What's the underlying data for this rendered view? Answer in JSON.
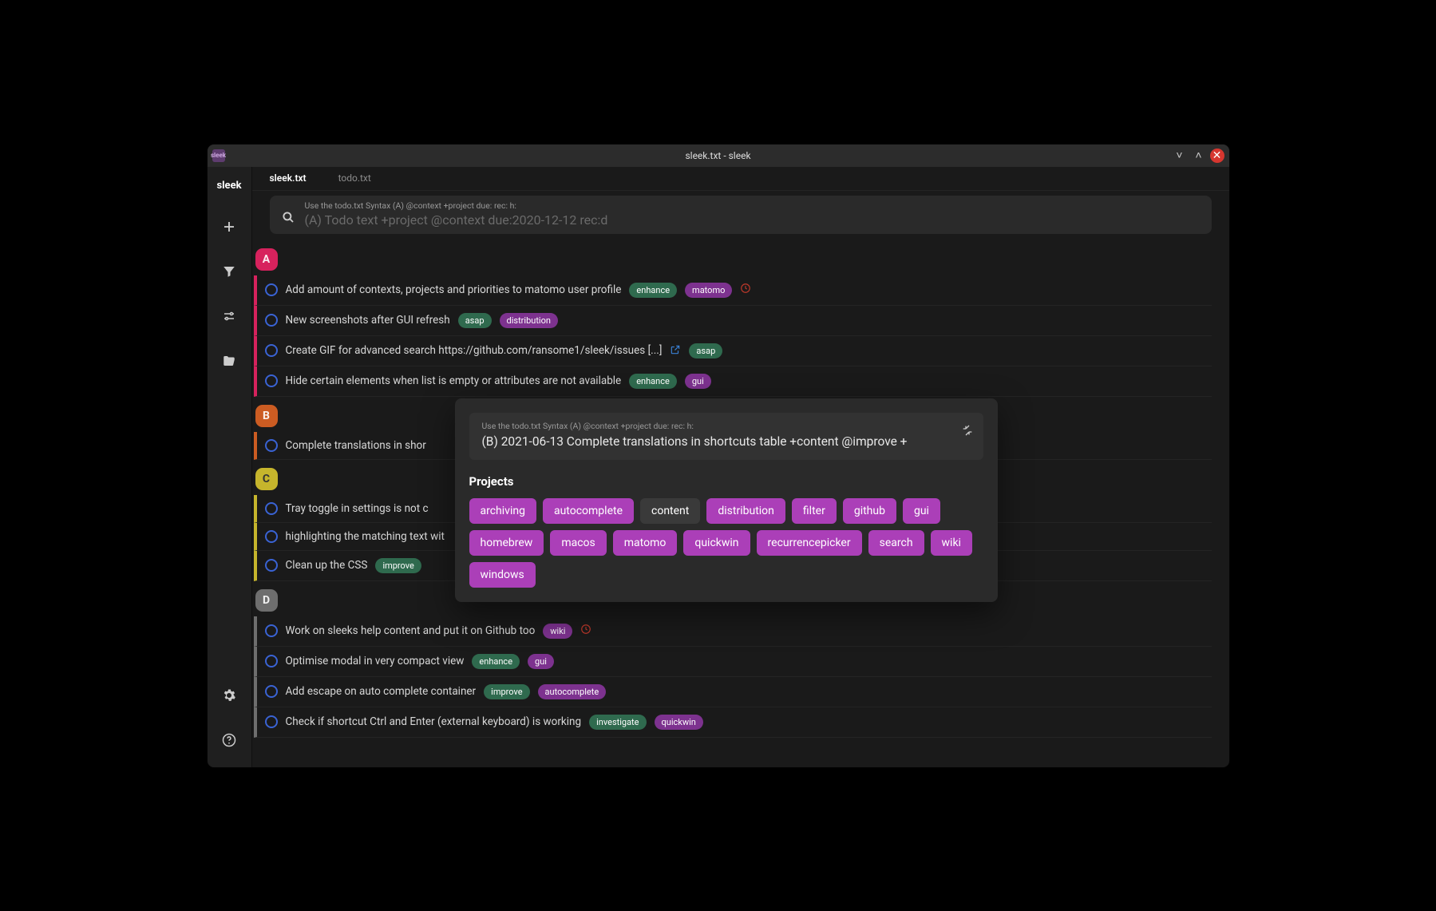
{
  "window": {
    "title": "sleek.txt - sleek",
    "app_icon_label": "sleek"
  },
  "sidebar": {
    "brand": "sleek"
  },
  "tabs": [
    {
      "label": "sleek.txt",
      "active": true
    },
    {
      "label": "todo.txt",
      "active": false
    }
  ],
  "search": {
    "hint": "Use the todo.txt Syntax (A) @context +project due: rec: h:",
    "placeholder": "(A) Todo text +project @context due:2020-12-12 rec:d"
  },
  "groups": [
    {
      "priority": "A",
      "rows": [
        {
          "text": "Add amount of contexts, projects and priorities to matomo user profile",
          "tags": [
            [
              "enhance",
              "green"
            ],
            [
              "matomo",
              "purple"
            ]
          ],
          "due": true
        },
        {
          "text": "New screenshots after GUI refresh",
          "tags": [
            [
              "asap",
              "green"
            ],
            [
              "distribution",
              "purple"
            ]
          ]
        },
        {
          "text": "Create GIF for advanced search https://github.com/ransome1/sleek/issues [...]",
          "tags": [
            [
              "asap",
              "green"
            ]
          ],
          "link": true
        },
        {
          "text": "Hide certain elements when list is empty or attributes are not available",
          "tags": [
            [
              "enhance",
              "green"
            ],
            [
              "gui",
              "purple"
            ]
          ]
        }
      ]
    },
    {
      "priority": "B",
      "rows": [
        {
          "text": "Complete translations in shor",
          "tags": []
        }
      ]
    },
    {
      "priority": "C",
      "rows": [
        {
          "text": "Tray toggle in settings is not c",
          "tags": []
        },
        {
          "text": "highlighting the matching text wit",
          "tags": []
        },
        {
          "text": "Clean up the CSS",
          "tags": [
            [
              "improve",
              "green"
            ]
          ]
        }
      ]
    },
    {
      "priority": "D",
      "rows": [
        {
          "text": "Work on sleeks help content and put it on Github too",
          "tags": [
            [
              "wiki",
              "purple"
            ]
          ],
          "due": true
        },
        {
          "text": "Optimise modal in very compact view",
          "tags": [
            [
              "enhance",
              "green"
            ],
            [
              "gui",
              "purple"
            ]
          ]
        },
        {
          "text": "Add escape on auto complete container",
          "tags": [
            [
              "improve",
              "green"
            ],
            [
              "autocomplete",
              "purple"
            ]
          ]
        },
        {
          "text": "Check if shortcut Ctrl and Enter (external keyboard) is working",
          "tags": [
            [
              "investigate",
              "green"
            ],
            [
              "quickwin",
              "purple"
            ]
          ]
        }
      ]
    }
  ],
  "popover": {
    "input_hint": "Use the todo.txt Syntax (A) @context +project due: rec: h:",
    "input_value": "(B) 2021-06-13 Complete translations in shortcuts table +content @improve +",
    "heading": "Projects",
    "chips": [
      "archiving",
      "autocomplete",
      "content",
      "distribution",
      "filter",
      "github",
      "gui",
      "homebrew",
      "macos",
      "matomo",
      "quickwin",
      "recurrencepicker",
      "search",
      "wiki",
      "windows"
    ],
    "selected_chip": "content"
  }
}
